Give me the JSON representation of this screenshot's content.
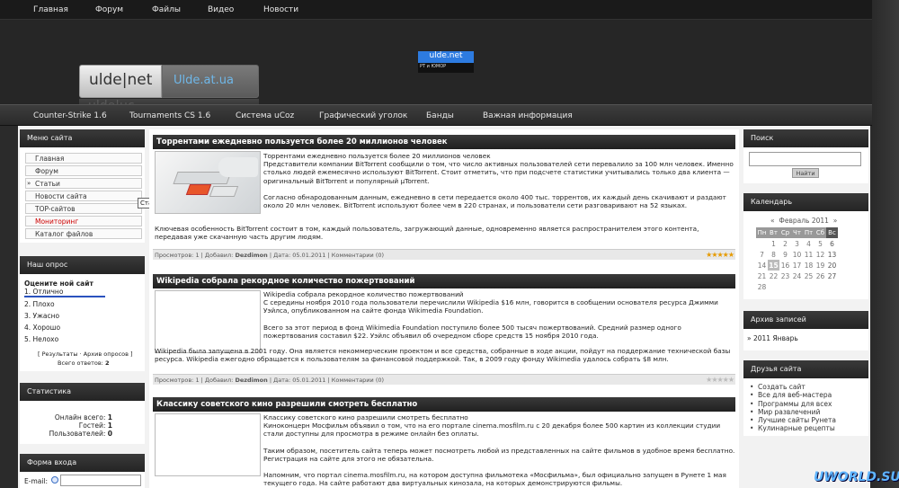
{
  "topnav": {
    "items": [
      "Главная",
      "Форум",
      "Файлы",
      "Видео",
      "Новости"
    ]
  },
  "logo": {
    "main": "ulde|net",
    "sub": "Ulde.at.ua",
    "reflection": "ulde|uc"
  },
  "banner": {
    "title": "ulde.net",
    "sub": "РТ и ЮМОР"
  },
  "catnav": {
    "items": [
      "Counter-Strike 1.6",
      "Tournaments CS 1.6",
      "Система uCoz",
      "Графический уголок",
      "Банды",
      "Важная информация"
    ]
  },
  "site_menu": {
    "title": "Меню сайта",
    "items": [
      "Главная",
      "Форум",
      "Статьи",
      "Новости сайта",
      "TOP-сайтов",
      "Мониторинг",
      "Каталог файлов"
    ],
    "tooltip": "Статьи",
    "accent": "#cc0000"
  },
  "poll": {
    "title": "Наш опрос",
    "question": "Оцените ной сайт",
    "options": [
      "1. Отлично",
      "2. Плохо",
      "3. Ужасно",
      "4. Хорошо",
      "5. Нелохо"
    ],
    "links": "[ Результаты · Архив опросов ]",
    "total_label": "Всего ответов:",
    "total": "2"
  },
  "stats": {
    "title": "Статистика",
    "online_label": "Онлайн всего:",
    "online": "1",
    "guests_label": "Гостей:",
    "guests": "1",
    "users_label": "Пользователей:",
    "users": "0"
  },
  "login": {
    "title": "Форма входа",
    "email_label": "E-mail:"
  },
  "news": [
    {
      "title": "Торрентами ежедневно пользуется более 20 миллионов человек",
      "p1": "Торрентами ежедневно пользуется более 20 миллионов человек",
      "p2": "Представители компании BitTorrent сообщили о том, что число активных пользователей сети перевалило за 100 млн человек. Именно столько людей ежемесячно используют BitTorrent. Стоит отметить, что при подсчете статистики учитывались только два клиента — оригинальный BitTorrent и популярный µTorrent.",
      "p3": "Согласно обнародованным данным, ежедневно в сети передается около 400 тыс. торрентов, их каждый день скачивают и раздают около 20 млн человек. BitTorrent используют более чем в 220 странах, и пользователи сети разговаривают на 52 языках.",
      "p4": "Ключевая особенность BitTorrent состоит в том, каждый пользователь, загружающий данные, одновременно является распространителем этого контента, передавая уже скачанную часть другим людям.",
      "meta": {
        "views_label": "Просмотров:",
        "views": "1",
        "added_label": "Добавил:",
        "author": "Dezdimon",
        "date_label": "Дата:",
        "date": "05.01.2011",
        "comments_label": "Комментарии",
        "comments": "(0)"
      },
      "rating": 5
    },
    {
      "title": "Wikipedia собрала рекордное количество пожертвований",
      "p1": "Wikipedia собрала рекордное количество пожертвований",
      "p2": "С середины ноября 2010 года пользователи перечислили Wikipedia $16 млн, говорится в сообщении основателя ресурса Джимми Уэйлса, опубликованном на сайте фонда Wikimedia Foundation.",
      "p3": "Всего за этот период в фонд Wikimedia Foundation поступило более 500 тысяч пожертвований. Средний размер одного пожертвования составил $22. Уэйлс объявил об очередном сборе средств 15 ноября 2010 года.",
      "p4": "Wikipedia была запущена в 2001 году. Она является некоммерческим проектом и все средства, собранные в ходе акции, пойдут на поддержание технической базы ресурса. Wikipedia ежегодно обращается к пользователям за финансовой поддержкой. Так, в 2009 году фонду Wikimedia удалось собрать $8 млн.",
      "meta": {
        "views_label": "Просмотров:",
        "views": "1",
        "added_label": "Добавил:",
        "author": "Dezdimon",
        "date_label": "Дата:",
        "date": "05.01.2011",
        "comments_label": "Комментарии",
        "comments": "(0)"
      },
      "rating": 0
    },
    {
      "title": "Классику советского кино разрешили смотреть бесплатно",
      "p1": "Классику советского кино разрешили смотреть бесплатно",
      "p2": "Киноконцерн Мосфильм объявил о том, что на его портале cinema.mosfilm.ru с 20 декабря более 500 картин из коллекции студии стали доступны для просмотра в режиме онлайн без оплаты.",
      "p3": "Таким образом, посетитель сайта теперь может посмотреть любой из представленных на сайте фильмов в удобное время бесплатно. Регистрация на сайте для этого не обязательна.",
      "p4": "Напомним, что портал cinema.mosfilm.ru, на котором доступна фильмотека «Мосфильма», был официально запущен в Рунете 1 мая текущего года. На сайте работают два виртуальных кинозала, на которых демонстрируются фильмы."
    }
  ],
  "search": {
    "title": "Поиск",
    "button": "Найти"
  },
  "calendar": {
    "title": "Календарь",
    "prev": "«",
    "month": "Февраль 2011",
    "next": "»",
    "days": [
      "Пн",
      "Вт",
      "Ср",
      "Чт",
      "Пт",
      "Сб",
      "Вс"
    ],
    "weeks": [
      [
        "",
        "1",
        "2",
        "3",
        "4",
        "5",
        "6"
      ],
      [
        "7",
        "8",
        "9",
        "10",
        "11",
        "12",
        "13"
      ],
      [
        "14",
        "15",
        "16",
        "17",
        "18",
        "19",
        "20"
      ],
      [
        "21",
        "22",
        "23",
        "24",
        "25",
        "26",
        "27"
      ],
      [
        "28",
        "",
        "",
        "",
        "",
        "",
        ""
      ]
    ],
    "today": "15"
  },
  "archive": {
    "title": "Архив записей",
    "items": [
      "2011 Январь"
    ]
  },
  "friends": {
    "title": "Друзья сайта",
    "items": [
      "Создать сайт",
      "Все для веб-мастера",
      "Программы для всех",
      "Мир развлечений",
      "Лучшие сайты Рунета",
      "Кулинарные рецепты"
    ]
  },
  "watermark": "UWORLD.SU"
}
